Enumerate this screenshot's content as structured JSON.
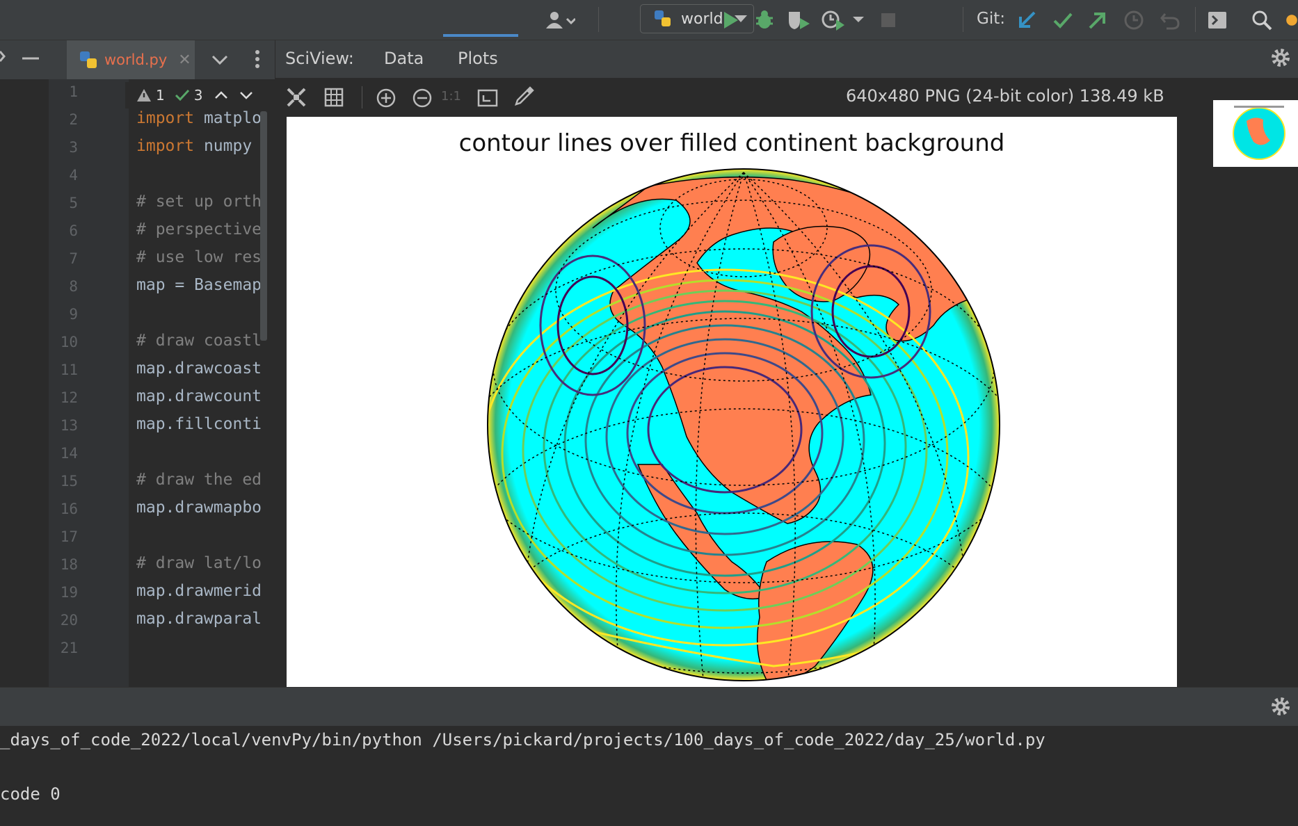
{
  "toolbar": {
    "run_config": "world",
    "git_label": "Git:",
    "icons": [
      "user-icon",
      "run-icon",
      "debug-icon",
      "coverage-icon",
      "profile-icon",
      "stop-icon",
      "git-update-icon",
      "git-commit-icon",
      "git-push-icon",
      "history-icon",
      "rollback-icon",
      "terminal-icon",
      "search-icon"
    ]
  },
  "editor": {
    "tab_name": "world.py",
    "inspection": {
      "warnings": "1",
      "ok": "3"
    },
    "line_numbers": [
      "1",
      "2",
      "3",
      "4",
      "5",
      "6",
      "7",
      "8",
      "9",
      "10",
      "11",
      "12",
      "13",
      "14",
      "15",
      "16",
      "17",
      "18",
      "19",
      "20",
      "21"
    ],
    "lines": [
      {
        "n": 2,
        "kw": "import",
        "rest": " matplo"
      },
      {
        "n": 3,
        "kw": "import",
        "rest": " numpy "
      },
      {
        "n": 5,
        "cm": "# set up orth"
      },
      {
        "n": 6,
        "cm": "# perspective"
      },
      {
        "n": 7,
        "cm": "# use low res"
      },
      {
        "n": 8,
        "text": "map = Basemap"
      },
      {
        "n": 10,
        "cm": "# draw coastl"
      },
      {
        "n": 11,
        "text": "map.drawcoast"
      },
      {
        "n": 12,
        "text": "map.drawcount"
      },
      {
        "n": 13,
        "text": "map.fillconti"
      },
      {
        "n": 15,
        "cm": "# draw the ed"
      },
      {
        "n": 16,
        "text": "map.drawmapbo"
      },
      {
        "n": 18,
        "cm": "# draw lat/lo"
      },
      {
        "n": 19,
        "text": "map.drawmerid"
      },
      {
        "n": 20,
        "text": "map.drawparal"
      }
    ]
  },
  "sciview": {
    "title": "SciView:",
    "tabs": [
      "Data",
      "Plots"
    ],
    "active_tab": "Plots",
    "image_info": "640x480 PNG (24-bit color) 138.49 kB",
    "plot_title": "contour lines over filled continent background",
    "colors": {
      "ocean": "#00ffff",
      "land": "#ff7f50",
      "contour_low": "#440154",
      "contour_high": "#fde725"
    }
  },
  "run": {
    "command": "_days_of_code_2022/local/venvPy/bin/python /Users/pickard/projects/100_days_of_code_2022/day_25/world.py",
    "exit": "code 0"
  }
}
